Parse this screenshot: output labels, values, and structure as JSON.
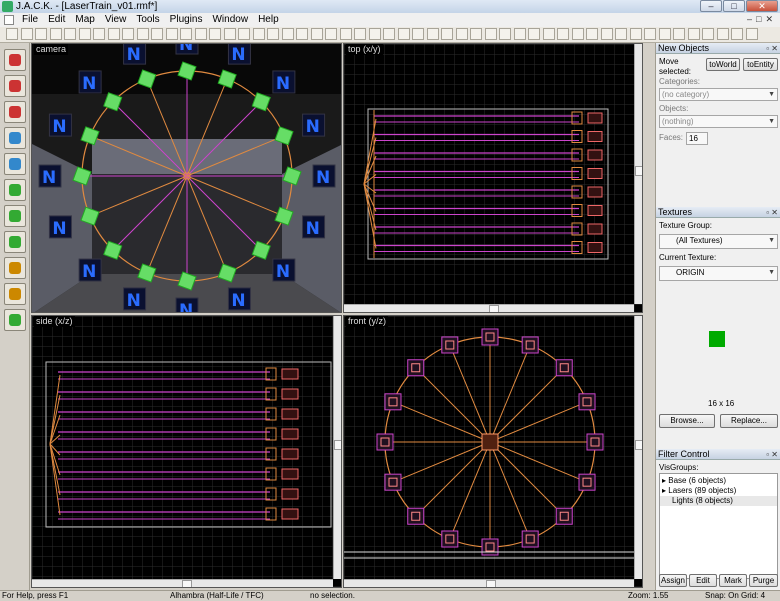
{
  "window": {
    "title": "J.A.C.K. - [LaserTrain_v01.rmf*]",
    "minimize": "–",
    "maximize": "□",
    "close": "✕"
  },
  "menu": [
    "File",
    "Edit",
    "Map",
    "View",
    "Tools",
    "Plugins",
    "Window",
    "Help"
  ],
  "viewports": {
    "camera": "camera",
    "top": "top (x/y)",
    "side": "side (x/z)",
    "front": "front (y/z)"
  },
  "new_objects": {
    "title": "New Objects",
    "move_selected": "Move selected:",
    "to_world": "toWorld",
    "to_entity": "toEntity",
    "categories_label": "Categories:",
    "categories_value": "(no category)",
    "objects_label": "Objects:",
    "objects_value": "(nothing)",
    "faces_label": "Faces:",
    "faces_value": "16"
  },
  "textures": {
    "title": "Textures",
    "group_label": "Texture Group:",
    "group_value": "(All Textures)",
    "current_label": "Current Texture:",
    "current_value": "ORIGIN",
    "size": "16 x 16",
    "browse": "Browse...",
    "replace": "Replace..."
  },
  "filter": {
    "title": "Filter Control",
    "visgroups_label": "VisGroups:",
    "items": [
      "Base (6 objects)",
      "Lasers (89 objects)",
      "Lights (8 objects)"
    ],
    "assign": "Assign",
    "edit": "Edit",
    "mark": "Mark",
    "purge": "Purge"
  },
  "status": {
    "help": "For Help, press F1",
    "game": "Alhambra (Half-Life / TFC)",
    "selection": "no selection.",
    "zoom": "Zoom: 1.55",
    "snap": "Snap: On Grid: 4"
  },
  "colors": {
    "wire": "#cc44cc",
    "orange": "#e08a40",
    "green": "#66dd66",
    "accent": "#3a6ea5"
  }
}
